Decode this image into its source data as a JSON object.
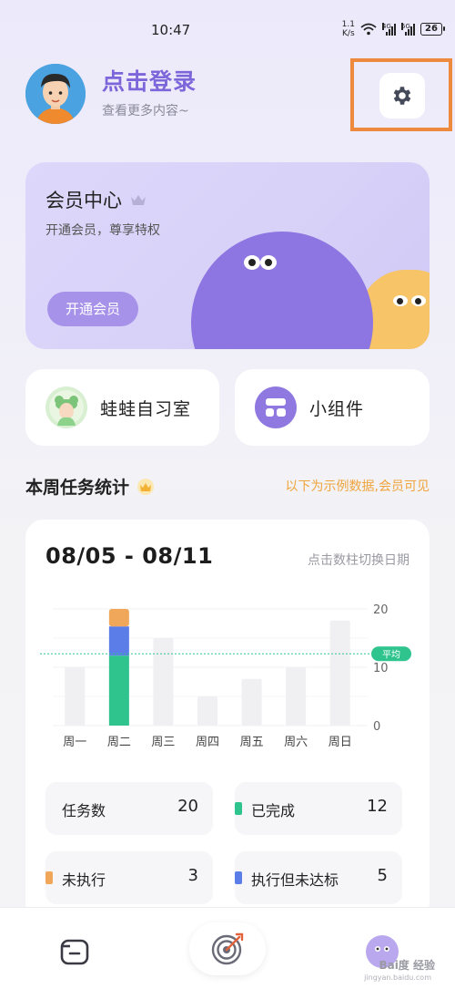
{
  "status_bar": {
    "time": "10:47",
    "net_speed_value": "1.1",
    "net_speed_unit": "K/s",
    "sim1": "4G",
    "sim2": "5G",
    "battery": "26"
  },
  "header": {
    "login_title": "点击登录",
    "login_subtitle": "查看更多内容~",
    "settings_icon": "gear-icon",
    "highlight_color": "#ee8a3d"
  },
  "member_card": {
    "title": "会员中心",
    "subtitle": "开通会员，尊享特权",
    "button_label": "开通会员",
    "crown_icon": "crown-icon"
  },
  "quick_tiles": [
    {
      "label": "蛙蛙自习室",
      "icon": "frog-avatar-icon"
    },
    {
      "label": "小组件",
      "icon": "widget-icon"
    }
  ],
  "weekly": {
    "title": "本周任务统计",
    "note": "以下为示例数据,会员可见",
    "date_range": "08/05 - 08/11",
    "date_hint": "点击数柱切换日期"
  },
  "chart_data": {
    "type": "bar",
    "categories": [
      "周一",
      "周二",
      "周三",
      "周四",
      "周五",
      "周六",
      "周日"
    ],
    "values": [
      10,
      20,
      15,
      5,
      8,
      10,
      18
    ],
    "stacked_highlight": {
      "category": "周二",
      "segments": [
        {
          "name": "已完成",
          "value": 12,
          "color": "#2fc48d"
        },
        {
          "name": "执行但未达标",
          "value": 5,
          "color": "#5b7de8"
        },
        {
          "name": "未执行",
          "value": 3,
          "color": "#f0a75a"
        }
      ]
    },
    "bar_color": "#f0f0f2",
    "yticks": [
      0,
      10,
      20
    ],
    "ylim": [
      0,
      20
    ],
    "average": 12.3,
    "average_label": "平均",
    "average_color": "#2fc48d",
    "grid": true
  },
  "legend": [
    {
      "label": "任务数",
      "value": "20",
      "color": "#f6f6f8"
    },
    {
      "label": "已完成",
      "value": "12",
      "color": "#2fc48d"
    },
    {
      "label": "未执行",
      "value": "3",
      "color": "#f0a75a"
    },
    {
      "label": "执行但未达标",
      "value": "5",
      "color": "#5b7de8"
    }
  ],
  "bottom_nav": [
    {
      "icon": "calendar-icon"
    },
    {
      "icon": "target-icon"
    },
    {
      "icon": "profile-icon"
    }
  ],
  "watermark": {
    "text": "Bai度 经验",
    "sub": "jingyan.baidu.com"
  }
}
